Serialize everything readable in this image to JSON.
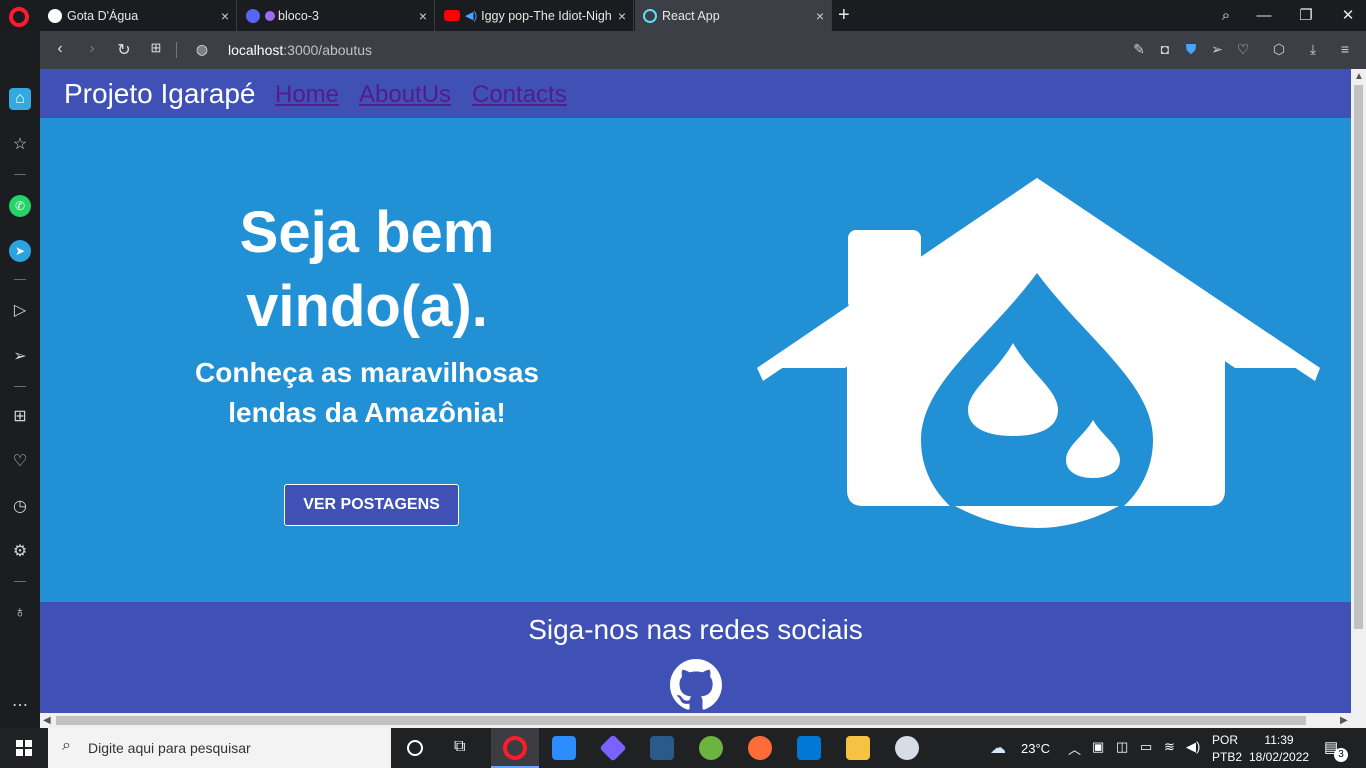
{
  "tabs": [
    {
      "label": "Gota D'Água",
      "favicon": "github-icon",
      "close": "×"
    },
    {
      "label": "bloco-3",
      "favicon": "discord-icon",
      "close": "×"
    },
    {
      "label": "Iggy pop-The Idiot-Nigh",
      "favicon": "youtube-icon",
      "close": "×"
    },
    {
      "label": "React App",
      "favicon": "react-icon",
      "close": "×"
    }
  ],
  "new_tab": "+",
  "address": {
    "host": "localhost",
    "path": ":3000/aboutus"
  },
  "page": {
    "brand": "Projeto Igarapé",
    "nav": [
      "Home",
      "AboutUs",
      "Contacts"
    ],
    "hero_title": "Seja bem vindo(a).",
    "hero_subtitle": "Conheça as maravilhosas lendas da Amazônia!",
    "hero_button": "VER POSTAGENS",
    "footer_title": "Siga-nos nas redes sociais"
  },
  "taskbar": {
    "search_placeholder": "Digite aqui para pesquisar",
    "weather": "23°C",
    "lang_1": "POR",
    "lang_2": "PTB2",
    "time": "11:39",
    "date": "18/02/2022",
    "notifications": "3"
  },
  "colors": {
    "primary": "#3f51b5",
    "hero": "#2190d4",
    "link": "#551a8b"
  }
}
